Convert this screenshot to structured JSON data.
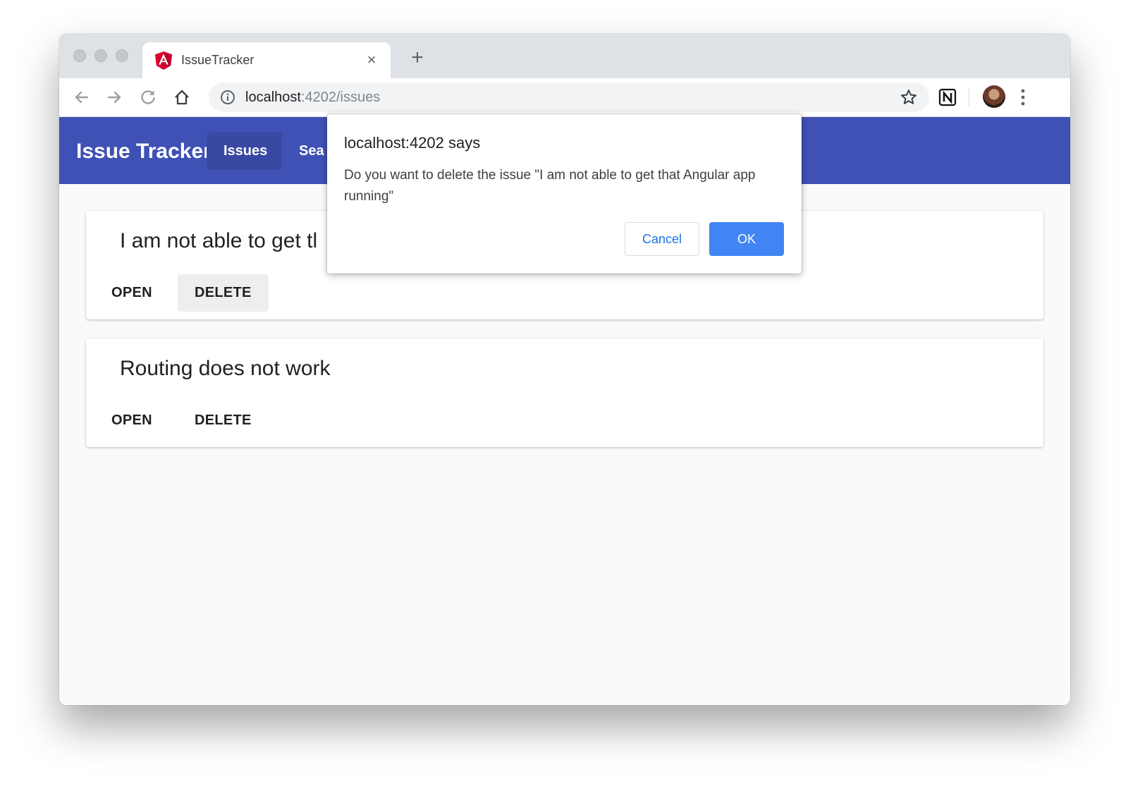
{
  "browser": {
    "tab_title": "IssueTracker",
    "tab_close": "×",
    "new_tab": "+",
    "url_host": "localhost",
    "url_path": ":4202/issues"
  },
  "app": {
    "brand": "Issue Tracker",
    "nav": [
      {
        "label": "Issues",
        "active": true
      },
      {
        "label": "Sea"
      }
    ]
  },
  "issues": [
    {
      "title": "I am not able to get tl",
      "open_label": "OPEN",
      "delete_label": "DELETE"
    },
    {
      "title": "Routing does not work",
      "open_label": "OPEN",
      "delete_label": "DELETE"
    }
  ],
  "dialog": {
    "title": "localhost:4202 says",
    "message": "Do you want to delete the issue \"I am not able to get that Angular app running\"",
    "cancel_label": "Cancel",
    "ok_label": "OK"
  },
  "colors": {
    "appbar": "#3f51b5",
    "ok_button": "#4285f4",
    "cancel_text": "#1a73e8"
  },
  "icons": [
    "angular-favicon-icon",
    "back-arrow-icon",
    "forward-arrow-icon",
    "reload-icon",
    "home-icon",
    "info-icon",
    "star-icon",
    "notion-icon",
    "kebab-menu-icon"
  ]
}
